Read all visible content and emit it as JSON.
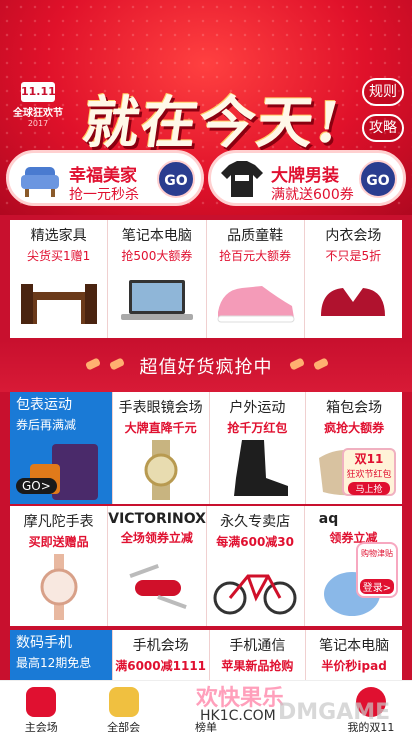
{
  "banner": {
    "logo": {
      "badge": "11.11",
      "line": "全球狂欢节",
      "year": "2017"
    },
    "headline": "就在今天!",
    "rules_btn": "规则",
    "strategy_btn": "攻略",
    "promos": [
      {
        "title": "幸福美家",
        "subtitle": "抢一元秒杀",
        "go": "GO"
      },
      {
        "title": "大牌男装",
        "subtitle": "满就送600券",
        "go": "GO"
      }
    ]
  },
  "row1": [
    {
      "title": "精选家具",
      "sub": "尖货买1赠1"
    },
    {
      "title": "笔记本电脑",
      "sub": "抢500大额券"
    },
    {
      "title": "品质童鞋",
      "sub": "抢百元大额券"
    },
    {
      "title": "内衣会场",
      "sub": "不只是5折"
    }
  ],
  "divider": {
    "text": "超值好货疯抢中"
  },
  "row2": [
    {
      "title": "包表运动",
      "sub": "券后再满减",
      "go": "GO>"
    },
    {
      "title": "手表眼镜会场",
      "sub": "大牌直降千元"
    },
    {
      "title": "户外运动",
      "sub": "抢千万红包"
    },
    {
      "title": "箱包会场",
      "sub": "疯抢大额券",
      "badge": "双11",
      "badge2": "狂欢节红包",
      "badge3": "马上抢"
    }
  ],
  "row3": [
    {
      "title": "摩凡陀手表",
      "sub": "买即送赠品"
    },
    {
      "title": "VICTORINOX",
      "sub": "全场领券立减"
    },
    {
      "title": "永久专卖店",
      "sub": "每满600减30"
    },
    {
      "title": "aq",
      "sub": "领券立减",
      "tag": "购物津贴",
      "tag2": "登录>"
    }
  ],
  "row4": [
    {
      "title": "数码手机",
      "sub": "最高12期免息"
    },
    {
      "title": "手机会场",
      "sub": "满6000减1111"
    },
    {
      "title": "手机通信",
      "sub": "苹果新品抢购"
    },
    {
      "title": "笔记本电脑",
      "sub": "半价秒ipad"
    }
  ],
  "tabs": [
    {
      "label": "主会场"
    },
    {
      "label": "全部会"
    },
    {
      "label": "榜单"
    },
    {
      "label": ""
    },
    {
      "label": "我的双11"
    }
  ],
  "watermark": {
    "line1": "欢快果乐",
    "line2": "HK1C.COM",
    "line3": "DMGAME"
  },
  "colors": {
    "primary": "#e01030",
    "blue": "#1a7ad6",
    "go": "#2a3d8f"
  }
}
